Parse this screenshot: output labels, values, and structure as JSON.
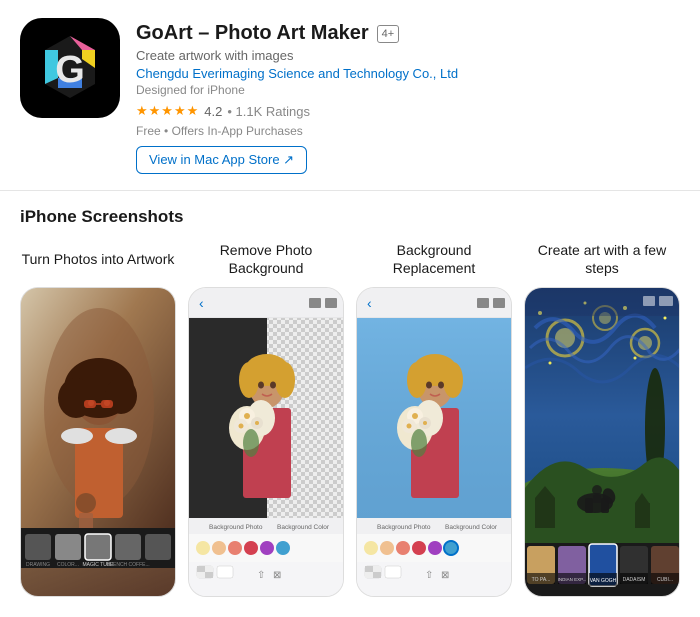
{
  "app": {
    "title": "GoArt – Photo Art Maker",
    "age_badge": "4+",
    "subtitle": "Create artwork with images",
    "developer": "Chengdu Everimaging Science and Technology Co., Ltd",
    "platform": "Designed for iPhone",
    "rating_stars": "★★★★★",
    "rating_value": "4.2",
    "rating_count": "• 1.1K Ratings",
    "price": "Free",
    "price_note": "• Offers In-App Purchases",
    "store_button": "View in Mac App Store ↗",
    "icon_bg": "#000000"
  },
  "screenshots": {
    "section_title": "iPhone Screenshots",
    "items": [
      {
        "label": "Turn Photos into Artwork",
        "id": "phone1"
      },
      {
        "label": "Remove Photo Background",
        "id": "phone2"
      },
      {
        "label": "Background Replacement",
        "id": "phone3"
      },
      {
        "label": "Create art with a few steps",
        "id": "phone4"
      }
    ],
    "phone2": {
      "labels": [
        "Background Photo",
        "Background Color"
      ],
      "colors": [
        "#f5e6a3",
        "#f0c090",
        "#e88070",
        "#d44050",
        "#a040c0",
        "#40a0d0"
      ],
      "icons": [
        "checkered",
        "white"
      ]
    },
    "phone3": {
      "labels": [
        "Background Photo",
        "Background Color"
      ],
      "colors": [
        "#f5e6a3",
        "#f0c090",
        "#e88070",
        "#d44050",
        "#a040c0",
        "#40a0d0"
      ],
      "icons": [
        "checkered",
        "white"
      ]
    },
    "phone4": {
      "thumbs": [
        {
          "label": "TO PA...",
          "bg": "#c8a060"
        },
        {
          "label": "INDIAN EXP...",
          "bg": "#8060a0"
        },
        {
          "label": "VAN GOGH",
          "bg": "#2050a0"
        },
        {
          "label": "DADAISM",
          "bg": "#303030"
        },
        {
          "label": "CUBI...",
          "bg": "#604030"
        }
      ]
    }
  }
}
